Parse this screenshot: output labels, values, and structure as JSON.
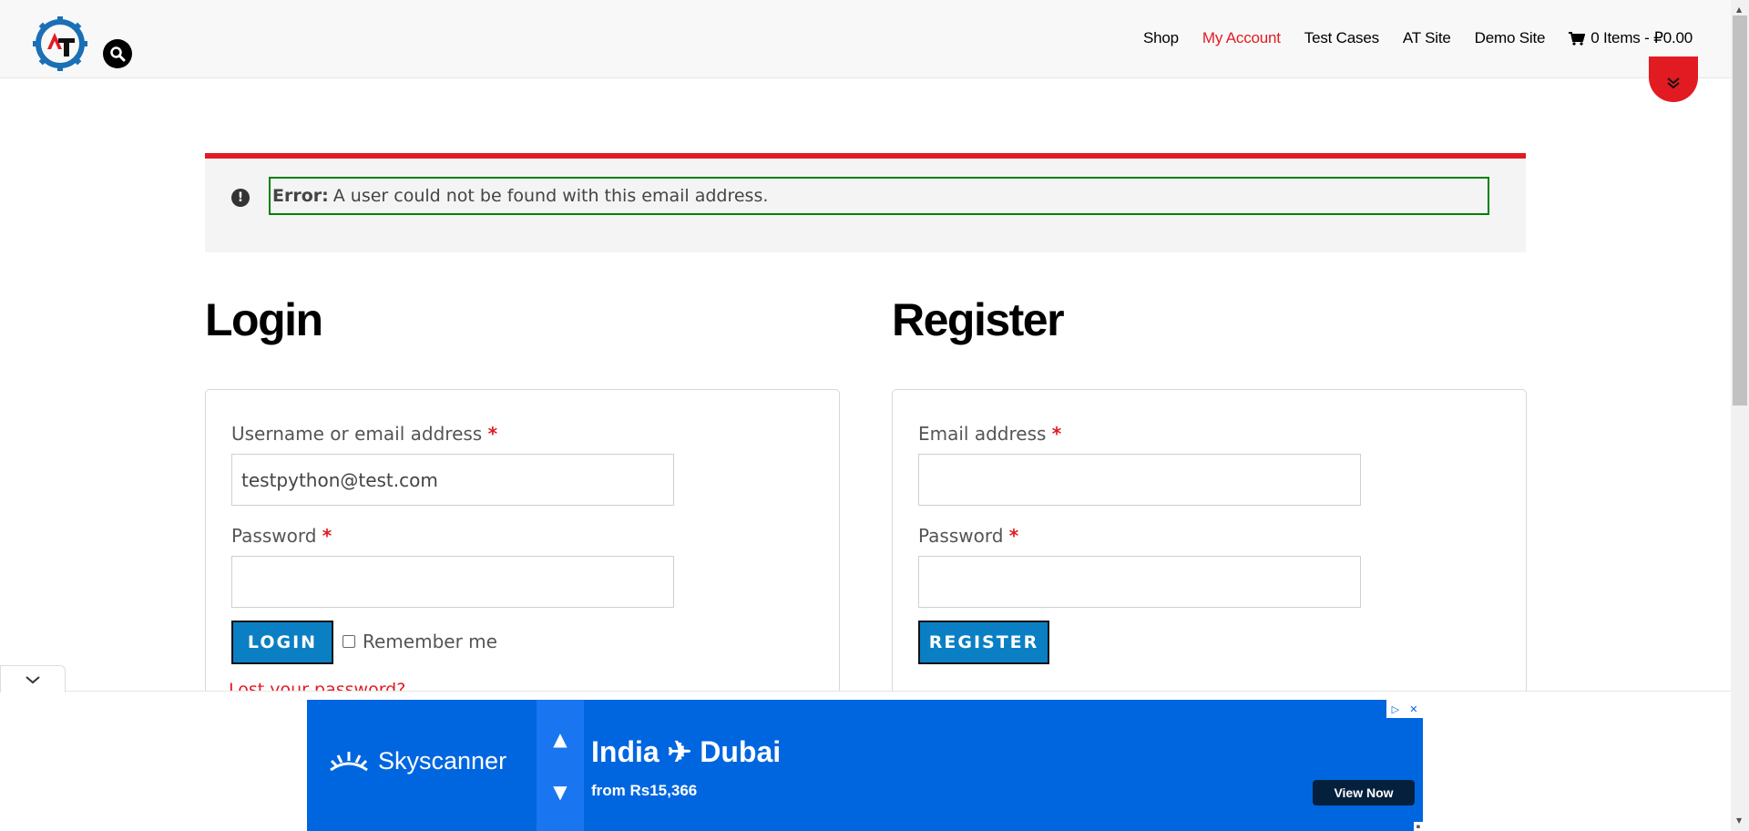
{
  "header": {
    "nav": [
      {
        "label": "Shop",
        "active": false
      },
      {
        "label": "My Account",
        "active": true
      },
      {
        "label": "Test Cases",
        "active": false
      },
      {
        "label": "AT Site",
        "active": false
      },
      {
        "label": "Demo Site",
        "active": false
      }
    ],
    "cart_label": "0 Items - ₽0.00"
  },
  "notice": {
    "prefix": "Error:",
    "message": "A user could not be found with this email address."
  },
  "login": {
    "title": "Login",
    "username_label": "Username or email address",
    "username_value": "testpython@test.com",
    "password_label": "Password",
    "button": "LOGIN",
    "remember": "Remember me",
    "lost_password": "Lost your password?"
  },
  "register": {
    "title": "Register",
    "email_label": "Email address",
    "password_label": "Password",
    "button": "REGISTER"
  },
  "required_mark": "*",
  "ad": {
    "brand": "Skyscanner",
    "route_from": "India",
    "route_to": "Dubai",
    "price": "from Rs15,366",
    "button": "View Now"
  },
  "colors": {
    "accent_red": "#e21b22",
    "button_blue": "#0a7fc4",
    "ad_blue": "#0066e0",
    "notice_border": "#008000"
  }
}
